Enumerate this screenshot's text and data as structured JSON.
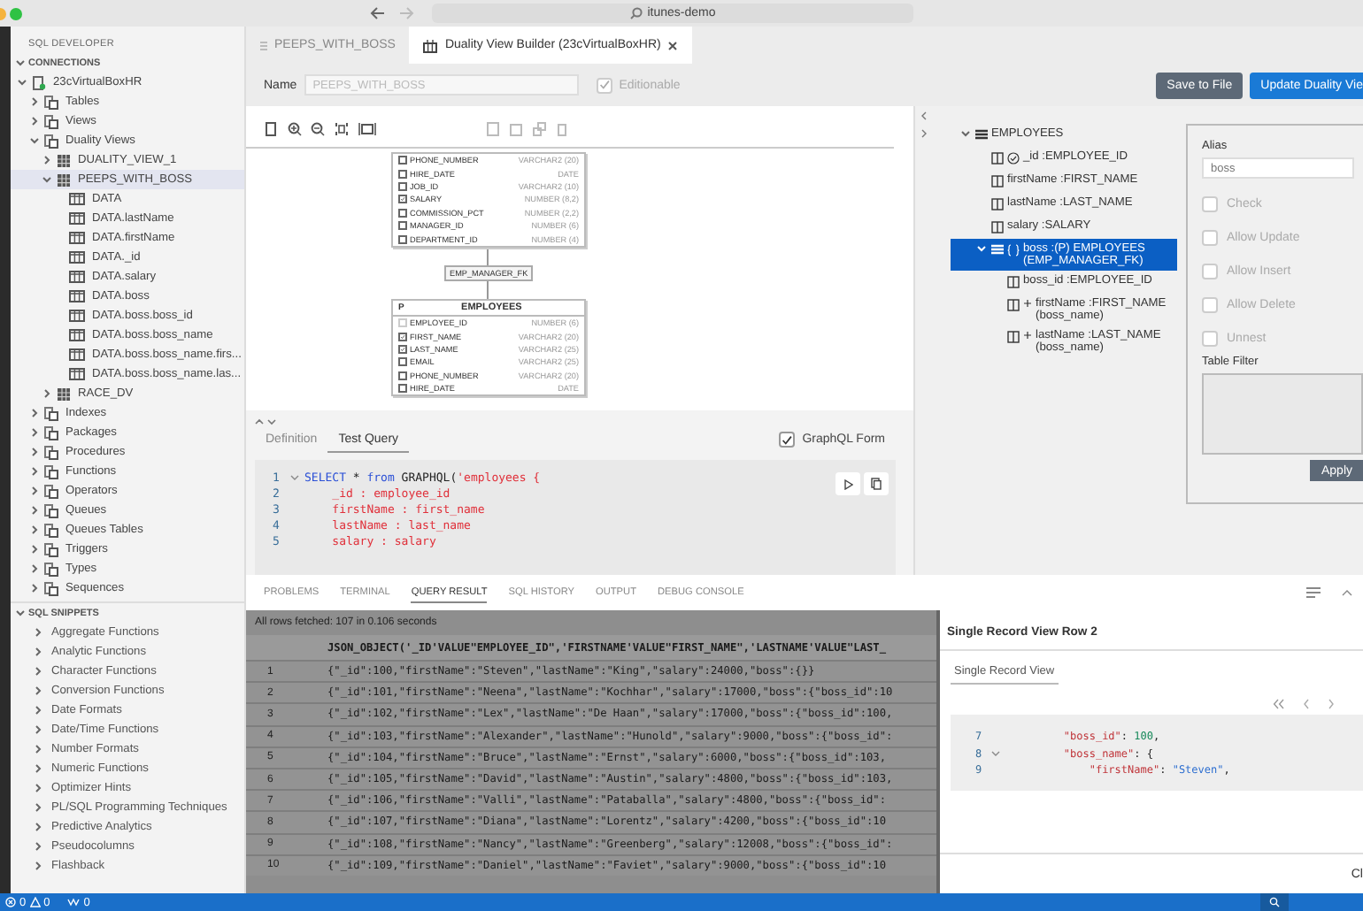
{
  "window": {
    "address": "itunes-demo"
  },
  "sidebar": {
    "title": "SQL DEVELOPER",
    "connections": {
      "label": "CONNECTIONS",
      "expanded": true,
      "items": [
        {
          "label": "23cVirtualBoxHR",
          "kind": "connection",
          "expanded": true,
          "selected": false,
          "children": [
            {
              "label": "Tables",
              "kind": "folder",
              "expanded": false,
              "selected": false
            },
            {
              "label": "Views",
              "kind": "folder",
              "expanded": false,
              "selected": false
            },
            {
              "label": "Duality Views",
              "kind": "folder",
              "expanded": true,
              "selected": false,
              "children": [
                {
                  "label": "DUALITY_VIEW_1",
                  "kind": "view",
                  "expanded": false,
                  "selected": false
                },
                {
                  "label": "PEEPS_WITH_BOSS",
                  "kind": "view",
                  "expanded": true,
                  "selected": true,
                  "children": [
                    {
                      "label": "DATA",
                      "kind": "column",
                      "selected": false
                    },
                    {
                      "label": "DATA.lastName",
                      "kind": "column",
                      "selected": false
                    },
                    {
                      "label": "DATA.firstName",
                      "kind": "column",
                      "selected": false
                    },
                    {
                      "label": "DATA._id",
                      "kind": "column",
                      "selected": false
                    },
                    {
                      "label": "DATA.salary",
                      "kind": "column",
                      "selected": false
                    },
                    {
                      "label": "DATA.boss",
                      "kind": "column",
                      "selected": false
                    },
                    {
                      "label": "DATA.boss.boss_id",
                      "kind": "column",
                      "selected": false
                    },
                    {
                      "label": "DATA.boss.boss_name",
                      "kind": "column",
                      "selected": false
                    },
                    {
                      "label": "DATA.boss.boss_name.firs...",
                      "kind": "column",
                      "selected": false
                    },
                    {
                      "label": "DATA.boss.boss_name.las...",
                      "kind": "column",
                      "selected": false
                    }
                  ]
                },
                {
                  "label": "RACE_DV",
                  "kind": "view",
                  "expanded": false,
                  "selected": false
                }
              ]
            },
            {
              "label": "Indexes",
              "kind": "folder",
              "expanded": false,
              "selected": false
            },
            {
              "label": "Packages",
              "kind": "folder",
              "expanded": false,
              "selected": false
            },
            {
              "label": "Procedures",
              "kind": "folder",
              "expanded": false,
              "selected": false
            },
            {
              "label": "Functions",
              "kind": "folder",
              "expanded": false,
              "selected": false
            },
            {
              "label": "Operators",
              "kind": "folder",
              "expanded": false,
              "selected": false
            },
            {
              "label": "Queues",
              "kind": "folder",
              "expanded": false,
              "selected": false
            },
            {
              "label": "Queues Tables",
              "kind": "folder",
              "expanded": false,
              "selected": false
            },
            {
              "label": "Triggers",
              "kind": "folder",
              "expanded": false,
              "selected": false
            },
            {
              "label": "Types",
              "kind": "folder",
              "expanded": false,
              "selected": false
            },
            {
              "label": "Sequences",
              "kind": "folder",
              "expanded": false,
              "selected": false
            }
          ]
        }
      ]
    },
    "snippets": {
      "label": "SQL SNIPPETS",
      "expanded": true,
      "items": [
        {
          "label": "Aggregate Functions",
          "expanded": false
        },
        {
          "label": "Analytic Functions",
          "expanded": false
        },
        {
          "label": "Character Functions",
          "expanded": false
        },
        {
          "label": "Conversion Functions",
          "expanded": false
        },
        {
          "label": "Date Formats",
          "expanded": false
        },
        {
          "label": "Date/Time Functions",
          "expanded": false
        },
        {
          "label": "Number Formats",
          "expanded": false
        },
        {
          "label": "Numeric Functions",
          "expanded": false
        },
        {
          "label": "Optimizer Hints",
          "expanded": false
        },
        {
          "label": "PL/SQL Programming Techniques",
          "expanded": false
        },
        {
          "label": "Predictive Analytics",
          "expanded": false
        },
        {
          "label": "Pseudocolumns",
          "expanded": false
        },
        {
          "label": "Flashback",
          "expanded": false
        }
      ]
    }
  },
  "editor_tabs": [
    {
      "label": "PEEPS_WITH_BOSS",
      "selected": false,
      "closable": false
    },
    {
      "label": "Duality View Builder (23cVirtualBoxHR)",
      "selected": true,
      "closable": true
    }
  ],
  "toolbar": {
    "name_label": "Name",
    "name_value": "PEEPS_WITH_BOSS",
    "editionable": {
      "label": "Editionable",
      "checked": true,
      "disabled": true
    },
    "buttons": [
      {
        "label": "Save to File",
        "kind": "secondary"
      },
      {
        "label": "Update Duality Vie",
        "kind": "primary"
      }
    ]
  },
  "diagram": {
    "parent_table": {
      "columns": [
        {
          "name": "PHONE_NUMBER",
          "type": "VARCHAR2 (20)",
          "checked": false,
          "disabled": false
        },
        {
          "name": "HIRE_DATE",
          "type": "DATE",
          "checked": false,
          "disabled": false
        },
        {
          "name": "JOB_ID",
          "type": "VARCHAR2 (10)",
          "checked": false,
          "disabled": false
        },
        {
          "name": "SALARY",
          "type": "NUMBER (8,2)",
          "checked": true,
          "disabled": false
        },
        {
          "name": "COMMISSION_PCT",
          "type": "NUMBER (2,2)",
          "checked": false,
          "disabled": false
        },
        {
          "name": "MANAGER_ID",
          "type": "NUMBER (6)",
          "checked": false,
          "disabled": false
        },
        {
          "name": "DEPARTMENT_ID",
          "type": "NUMBER (4)",
          "checked": false,
          "disabled": false
        }
      ]
    },
    "relation": "EMP_MANAGER_FK",
    "child_table": {
      "key_label": "P",
      "title": "EMPLOYEES",
      "columns": [
        {
          "name": "EMPLOYEE_ID",
          "type": "NUMBER (6)",
          "checked": false,
          "disabled": true
        },
        {
          "name": "FIRST_NAME",
          "type": "VARCHAR2 (20)",
          "checked": true,
          "disabled": false
        },
        {
          "name": "LAST_NAME",
          "type": "VARCHAR2 (25)",
          "checked": true,
          "disabled": false
        },
        {
          "name": "EMAIL",
          "type": "VARCHAR2 (25)",
          "checked": false,
          "disabled": false
        },
        {
          "name": "PHONE_NUMBER",
          "type": "VARCHAR2 (20)",
          "checked": false,
          "disabled": false
        },
        {
          "name": "HIRE_DATE",
          "type": "DATE",
          "checked": false,
          "disabled": false
        }
      ]
    }
  },
  "definition_panel": {
    "tabs": [
      {
        "label": "Definition",
        "selected": false
      },
      {
        "label": "Test Query",
        "selected": true
      }
    ],
    "graphql_form": {
      "label": "GraphQL Form",
      "checked": true
    },
    "code": [
      {
        "number": "1",
        "foldable": true,
        "tokens": [
          {
            "text": "SELECT",
            "kind": "keyword"
          },
          {
            "text": " * ",
            "kind": "plain"
          },
          {
            "text": "from",
            "kind": "keyword"
          },
          {
            "text": " GRAPHQL(",
            "kind": "plain"
          },
          {
            "text": "'employees {",
            "kind": "string"
          }
        ]
      },
      {
        "number": "2",
        "foldable": false,
        "tokens": [
          {
            "text": "    _id : employee_id",
            "kind": "string"
          }
        ]
      },
      {
        "number": "3",
        "foldable": false,
        "tokens": [
          {
            "text": "    firstName : first_name",
            "kind": "string"
          }
        ]
      },
      {
        "number": "4",
        "foldable": false,
        "tokens": [
          {
            "text": "    lastName : last_name",
            "kind": "string"
          }
        ]
      },
      {
        "number": "5",
        "foldable": false,
        "tokens": [
          {
            "text": "    salary : salary",
            "kind": "string"
          }
        ]
      }
    ]
  },
  "structure": {
    "items": [
      {
        "label": "EMPLOYEES",
        "kind": "table",
        "expanded": true,
        "selected": false,
        "children": [
          {
            "label": "_id :EMPLOYEE_ID",
            "kind": "key",
            "selected": false
          },
          {
            "label": "firstName :FIRST_NAME",
            "kind": "column",
            "selected": false
          },
          {
            "label": "lastName :LAST_NAME",
            "kind": "column",
            "selected": false
          },
          {
            "label": "salary :SALARY",
            "kind": "column",
            "selected": false
          },
          {
            "label": "boss :(P) EMPLOYEES (EMP_MANAGER_FK)",
            "kind": "object",
            "expanded": true,
            "selected": true,
            "children": [
              {
                "label": "boss_id :EMPLOYEE_ID",
                "kind": "column",
                "selected": false
              },
              {
                "label": "firstName :FIRST_NAME (boss_name)",
                "kind": "flattened",
                "selected": false
              },
              {
                "label": "lastName :LAST_NAME (boss_name)",
                "kind": "flattened",
                "selected": false
              }
            ]
          }
        ]
      }
    ]
  },
  "properties": {
    "alias_label": "Alias",
    "alias_value": "boss",
    "options": [
      {
        "label": "Check",
        "checked": false,
        "disabled": true
      },
      {
        "label": "Allow Update",
        "checked": false,
        "disabled": true
      },
      {
        "label": "Allow Insert",
        "checked": false,
        "disabled": true
      },
      {
        "label": "Allow Delete",
        "checked": false,
        "disabled": true
      },
      {
        "label": "Unnest",
        "checked": false,
        "disabled": true
      }
    ],
    "filter_label": "Table Filter",
    "apply_button": "Apply"
  },
  "bottom_panel": {
    "tabs": [
      {
        "label": "PROBLEMS",
        "selected": false
      },
      {
        "label": "TERMINAL",
        "selected": false
      },
      {
        "label": "QUERY RESULT",
        "selected": true
      },
      {
        "label": "SQL HISTORY",
        "selected": false
      },
      {
        "label": "OUTPUT",
        "selected": false
      },
      {
        "label": "DEBUG CONSOLE",
        "selected": false
      }
    ],
    "result": {
      "summary": "All rows fetched: 107 in 0.106 seconds",
      "column": "JSON_OBJECT('_ID'VALUE\"EMPLOYEE_ID\",'FIRSTNAME'VALUE\"FIRST_NAME\",'LASTNAME'VALUE\"LAST_",
      "rows": [
        {
          "number": "1",
          "value": "{\"_id\":100,\"firstName\":\"Steven\",\"lastName\":\"King\",\"salary\":24000,\"boss\":{}}"
        },
        {
          "number": "2",
          "value": "{\"_id\":101,\"firstName\":\"Neena\",\"lastName\":\"Kochhar\",\"salary\":17000,\"boss\":{\"boss_id\":10"
        },
        {
          "number": "3",
          "value": "{\"_id\":102,\"firstName\":\"Lex\",\"lastName\":\"De Haan\",\"salary\":17000,\"boss\":{\"boss_id\":100,"
        },
        {
          "number": "4",
          "value": "{\"_id\":103,\"firstName\":\"Alexander\",\"lastName\":\"Hunold\",\"salary\":9000,\"boss\":{\"boss_id\":"
        },
        {
          "number": "5",
          "value": "{\"_id\":104,\"firstName\":\"Bruce\",\"lastName\":\"Ernst\",\"salary\":6000,\"boss\":{\"boss_id\":103,"
        },
        {
          "number": "6",
          "value": "{\"_id\":105,\"firstName\":\"David\",\"lastName\":\"Austin\",\"salary\":4800,\"boss\":{\"boss_id\":103,"
        },
        {
          "number": "7",
          "value": "{\"_id\":106,\"firstName\":\"Valli\",\"lastName\":\"Pataballa\",\"salary\":4800,\"boss\":{\"boss_id\":"
        },
        {
          "number": "8",
          "value": "{\"_id\":107,\"firstName\":\"Diana\",\"lastName\":\"Lorentz\",\"salary\":4200,\"boss\":{\"boss_id\":10"
        },
        {
          "number": "9",
          "value": "{\"_id\":108,\"firstName\":\"Nancy\",\"lastName\":\"Greenberg\",\"salary\":12008,\"boss\":{\"boss_id\":"
        },
        {
          "number": "10",
          "value": "{\"_id\":109,\"firstName\":\"Daniel\",\"lastName\":\"Faviet\",\"salary\":9000,\"boss\":{\"boss_id\":10"
        }
      ]
    }
  },
  "dialog": {
    "title": "Single Record View Row 2",
    "tabs": [
      {
        "label": "Single Record View",
        "selected": true
      }
    ],
    "code": [
      {
        "number": "7",
        "foldable": false,
        "tokens": [
          {
            "text": "        \"boss_id\"",
            "kind": "key"
          },
          {
            "text": ": ",
            "kind": "plain"
          },
          {
            "text": "100",
            "kind": "number"
          },
          {
            "text": ",",
            "kind": "plain"
          }
        ]
      },
      {
        "number": "8",
        "foldable": true,
        "tokens": [
          {
            "text": "        \"boss_name\"",
            "kind": "key"
          },
          {
            "text": ": {",
            "kind": "plain"
          }
        ]
      },
      {
        "number": "9",
        "foldable": false,
        "tokens": [
          {
            "text": "            \"firstName\"",
            "kind": "key"
          },
          {
            "text": ": ",
            "kind": "plain"
          },
          {
            "text": "\"Steven\"",
            "kind": "value"
          },
          {
            "text": ",",
            "kind": "plain"
          }
        ]
      }
    ],
    "close_button": "Cl"
  },
  "status_bar": {
    "errors": "0",
    "warnings": "0",
    "ports": "0"
  }
}
